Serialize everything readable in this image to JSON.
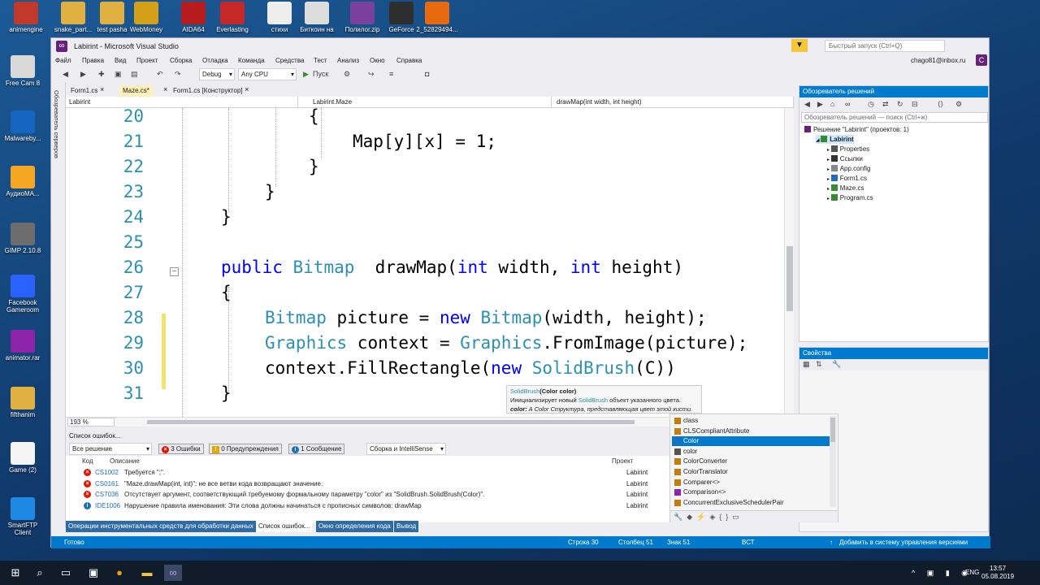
{
  "desktop": {
    "top_icons": [
      "animengine",
      "snake_part...",
      "test pasha",
      "WebMoney",
      "AIDA64",
      "Everlasting",
      "стихи",
      "Биткоин на",
      "Полилог.zip",
      "GeForce",
      "2_52829494..."
    ],
    "left_icons": [
      "Free Cam 8",
      "Malwareby...",
      "АудиоМА...",
      "GIMP 2.10.8",
      "Facebook Gameroom",
      "animator.rar",
      "fifthanim",
      "Game (2)",
      "SmartFTP Client"
    ],
    "colors": {
      "bg": "#15497a"
    }
  },
  "window": {
    "title": "Labirint - Microsoft Visual Studio",
    "quick_launch_placeholder": "Быстрый запуск (Ctrl+Q)",
    "user": "chago81@inbox.ru",
    "avatar": "C",
    "menu": [
      "Файл",
      "Правка",
      "Вид",
      "Проект",
      "Сборка",
      "Отладка",
      "Команда",
      "Средства",
      "Тест",
      "Анализ",
      "Окно",
      "Справка"
    ],
    "toolbar": {
      "config": "Debug",
      "platform": "Any CPU",
      "run": "Пуск"
    },
    "side_strip": "Обозреватель серверов"
  },
  "editor": {
    "tabs": [
      {
        "label": "Form1.cs",
        "active": false
      },
      {
        "label": "Maze.cs*",
        "active": true
      },
      {
        "label": "Form1.cs [Конструктор]",
        "active": false
      }
    ],
    "nav": {
      "project": "Labirint",
      "class": "Labirint.Maze",
      "member": "drawMap(int width, int height)"
    },
    "lines": [
      {
        "n": "20",
        "tokens": [
          [
            "{",
            "p"
          ]
        ]
      },
      {
        "n": "21",
        "tokens": [
          [
            "Map[y][x] = 1;",
            "p"
          ]
        ]
      },
      {
        "n": "22",
        "tokens": [
          [
            "}",
            "p"
          ]
        ]
      },
      {
        "n": "23",
        "tokens": [
          [
            "}",
            "p"
          ]
        ]
      },
      {
        "n": "24",
        "tokens": [
          [
            "}",
            "p"
          ]
        ]
      },
      {
        "n": "25",
        "tokens": []
      },
      {
        "n": "26",
        "tokens": [
          [
            "public ",
            "k"
          ],
          [
            "Bitmap",
            "t"
          ],
          [
            "  drawMap(",
            "p"
          ],
          [
            "int",
            "k"
          ],
          [
            " width, ",
            "p"
          ],
          [
            "int",
            "k"
          ],
          [
            " height)",
            "p"
          ]
        ]
      },
      {
        "n": "27",
        "tokens": [
          [
            "{",
            "p"
          ]
        ]
      },
      {
        "n": "28",
        "tokens": [
          [
            "Bitmap",
            "t"
          ],
          [
            " picture = ",
            "p"
          ],
          [
            "new ",
            "k"
          ],
          [
            "Bitmap",
            "t"
          ],
          [
            "(width, height);",
            "p"
          ]
        ]
      },
      {
        "n": "29",
        "tokens": [
          [
            "Graphics",
            "t"
          ],
          [
            " context = ",
            "p"
          ],
          [
            "Graphics",
            "t"
          ],
          [
            ".FromImage(picture);",
            "p"
          ]
        ]
      },
      {
        "n": "30",
        "tokens": [
          [
            "context.FillRectangle(",
            "p"
          ],
          [
            "new ",
            "k"
          ],
          [
            "SolidBrush",
            "t"
          ],
          [
            "(C))",
            "p"
          ]
        ]
      },
      {
        "n": "31",
        "tokens": [
          [
            "}",
            "p"
          ]
        ]
      }
    ],
    "zoom": "193 %",
    "tooltip": {
      "sig_type": "SolidBrush",
      "sig_rest": "(Color color)",
      "desc_pre": "Инициализирует новый ",
      "desc_type": "SolidBrush",
      "desc_post": " объект указанного цвета.",
      "param": "color:",
      "param_desc": " A Color Структура, представляющая цвет этой кисти."
    }
  },
  "autocomplete": {
    "items": [
      {
        "label": "class",
        "icon": "class-icon",
        "selected": false
      },
      {
        "label": "CLSCompliantAttribute",
        "icon": "class-icon",
        "selected": false
      },
      {
        "label": "Color",
        "icon": "struct-icon",
        "selected": true
      },
      {
        "label": "color",
        "icon": "parameter-icon",
        "selected": false
      },
      {
        "label": "ColorConverter",
        "icon": "class-icon",
        "selected": false
      },
      {
        "label": "ColorTranslator",
        "icon": "class-icon",
        "selected": false
      },
      {
        "label": "Comparer<>",
        "icon": "class-icon",
        "selected": false
      },
      {
        "label": "Comparison<>",
        "icon": "delegate-icon",
        "selected": false
      },
      {
        "label": "ConcurrentExclusiveSchedulerPair",
        "icon": "class-icon",
        "selected": false
      }
    ]
  },
  "error_list": {
    "title": "Список ошибок...",
    "scope": "Все решение",
    "errors_btn": "3 Ошибки",
    "warnings_btn": "0 Предупреждения",
    "messages_btn": "1 Сообщение",
    "build_filter": "Сборка и IntelliSense",
    "headers": {
      "code": "Код",
      "desc": "Описание",
      "project": "Проект"
    },
    "rows": [
      {
        "code": "CS1002",
        "desc": "Требуется \";\".",
        "project": "Labirint",
        "kind": "error"
      },
      {
        "code": "CS0161",
        "desc": "\"Maze.drawMap(int, int)\": не все ветви кода возвращают значение.",
        "project": "Labirint",
        "kind": "error"
      },
      {
        "code": "CS7036",
        "desc": "Отсутствует аргумент, соответствующий требуемому формальному параметру \"color\" из \"SolidBrush.SolidBrush(Color)\".",
        "project": "Labirint",
        "kind": "error"
      },
      {
        "code": "IDE1006",
        "desc": "Нарушение правила именования: Эти слова должны начинаться с прописных символов: drawMap",
        "project": "Labirint",
        "kind": "info"
      }
    ]
  },
  "bottom_tabs": [
    {
      "label": "Операции инструментальных средств для обработки данных",
      "active": false
    },
    {
      "label": "Список ошибок...",
      "active": true
    },
    {
      "label": "Окно определения кода",
      "active": false
    },
    {
      "label": "Вывод",
      "active": false
    }
  ],
  "solution": {
    "title": "Обозреватель решений",
    "search_placeholder": "Обозреватель решений — поиск (Ctrl+ж)",
    "tree": [
      {
        "label": "Решение \"Labirint\" (проектов: 1)",
        "indent": 0,
        "icon": "solution-icon"
      },
      {
        "label": "Labirint",
        "indent": 1,
        "icon": "project-icon",
        "selected": true
      },
      {
        "label": "Properties",
        "indent": 2,
        "icon": "wrench-icon"
      },
      {
        "label": "Ссылки",
        "indent": 2,
        "icon": "references-icon"
      },
      {
        "label": "App.config",
        "indent": 2,
        "icon": "config-icon"
      },
      {
        "label": "Form1.cs",
        "indent": 2,
        "icon": "form-icon"
      },
      {
        "label": "Maze.cs",
        "indent": 2,
        "icon": "csharp-file-icon"
      },
      {
        "label": "Program.cs",
        "indent": 2,
        "icon": "csharp-file-icon"
      }
    ]
  },
  "properties": {
    "title": "Свойства"
  },
  "status": {
    "ready": "Готово",
    "line": "Строка 30",
    "col": "Столбец 51",
    "ch": "Знак 51",
    "mode": "ВСТ",
    "vcs": "Добавить в систему управления версиями"
  },
  "taskbar": {
    "lang": "ENG",
    "time": "13:57",
    "date": "05.08.2019"
  }
}
